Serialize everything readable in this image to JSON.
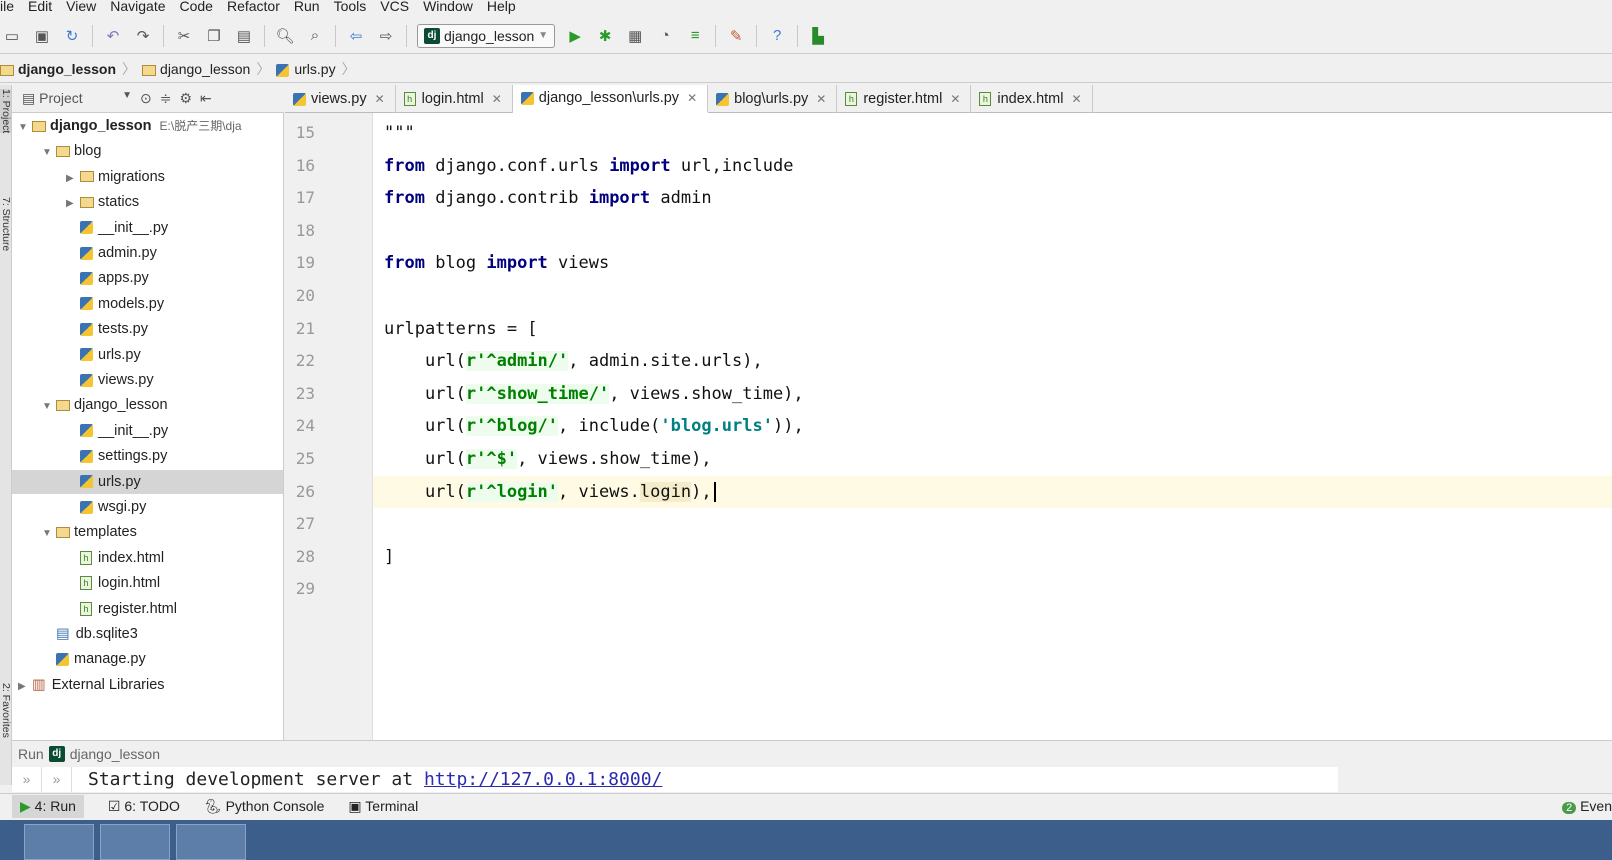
{
  "menu": [
    "ile",
    "Edit",
    "View",
    "Navigate",
    "Code",
    "Refactor",
    "Run",
    "Tools",
    "VCS",
    "Window",
    "Help"
  ],
  "toolbar": {
    "run_config": "django_lesson"
  },
  "breadcrumb": [
    "django_lesson",
    "django_lesson",
    "urls.py"
  ],
  "sidebar": {
    "title": "Project",
    "left_strip": [
      "1: Project",
      "7: Structure",
      "2: Favorites"
    ]
  },
  "tree": [
    {
      "label": "django_lesson",
      "extra": "E:\\脱产三期\\dja",
      "type": "folder",
      "depth": 0,
      "open": true
    },
    {
      "label": "blog",
      "type": "folder",
      "depth": 1,
      "open": true
    },
    {
      "label": "migrations",
      "type": "folder",
      "depth": 2,
      "open": false
    },
    {
      "label": "statics",
      "type": "folder",
      "depth": 2,
      "open": false
    },
    {
      "label": "__init__.py",
      "type": "py",
      "depth": 2
    },
    {
      "label": "admin.py",
      "type": "py",
      "depth": 2
    },
    {
      "label": "apps.py",
      "type": "py",
      "depth": 2
    },
    {
      "label": "models.py",
      "type": "py",
      "depth": 2
    },
    {
      "label": "tests.py",
      "type": "py",
      "depth": 2
    },
    {
      "label": "urls.py",
      "type": "py",
      "depth": 2
    },
    {
      "label": "views.py",
      "type": "py",
      "depth": 2
    },
    {
      "label": "django_lesson",
      "type": "folder",
      "depth": 1,
      "open": true
    },
    {
      "label": "__init__.py",
      "type": "py",
      "depth": 2
    },
    {
      "label": "settings.py",
      "type": "py",
      "depth": 2
    },
    {
      "label": "urls.py",
      "type": "py",
      "depth": 2,
      "selected": true
    },
    {
      "label": "wsgi.py",
      "type": "py",
      "depth": 2
    },
    {
      "label": "templates",
      "type": "folder",
      "depth": 1,
      "open": true
    },
    {
      "label": "index.html",
      "type": "html",
      "depth": 2
    },
    {
      "label": "login.html",
      "type": "html",
      "depth": 2
    },
    {
      "label": "register.html",
      "type": "html",
      "depth": 2
    },
    {
      "label": "db.sqlite3",
      "type": "db",
      "depth": 1
    },
    {
      "label": "manage.py",
      "type": "py",
      "depth": 1
    },
    {
      "label": "External Libraries",
      "type": "lib",
      "depth": 0,
      "open": false
    }
  ],
  "tabs": [
    {
      "label": "views.py",
      "type": "py"
    },
    {
      "label": "login.html",
      "type": "html"
    },
    {
      "label": "django_lesson\\urls.py",
      "type": "py",
      "active": true
    },
    {
      "label": "blog\\urls.py",
      "type": "py"
    },
    {
      "label": "register.html",
      "type": "html"
    },
    {
      "label": "index.html",
      "type": "html"
    }
  ],
  "code": [
    {
      "n": "15",
      "t": [
        [
          "c",
          "\"\"\""
        ]
      ]
    },
    {
      "n": "16",
      "t": [
        [
          "kw",
          "from"
        ],
        [
          "c",
          " django.conf.urls "
        ],
        [
          "kw",
          "import"
        ],
        [
          "c",
          " url,include"
        ]
      ]
    },
    {
      "n": "17",
      "t": [
        [
          "kw",
          "from"
        ],
        [
          "c",
          " django.contrib "
        ],
        [
          "kw",
          "import"
        ],
        [
          "c",
          " admin"
        ]
      ]
    },
    {
      "n": "18",
      "t": []
    },
    {
      "n": "19",
      "t": [
        [
          "kw",
          "from"
        ],
        [
          "c",
          " blog "
        ],
        [
          "kw",
          "import"
        ],
        [
          "c",
          " views"
        ]
      ]
    },
    {
      "n": "20",
      "t": []
    },
    {
      "n": "21",
      "t": [
        [
          "c",
          "urlpatterns = ["
        ]
      ]
    },
    {
      "n": "22",
      "t": [
        [
          "c",
          "    url("
        ],
        [
          "st",
          "r'^admin/'"
        ],
        [
          "c",
          ", admin.site.urls),"
        ]
      ]
    },
    {
      "n": "23",
      "t": [
        [
          "c",
          "    url("
        ],
        [
          "st",
          "r'^show_time/'"
        ],
        [
          "c",
          ", views.show_time),"
        ]
      ]
    },
    {
      "n": "24",
      "t": [
        [
          "c",
          "    url("
        ],
        [
          "st",
          "r'^blog/'"
        ],
        [
          "c",
          ", include("
        ],
        [
          "st2",
          "'blog.urls'"
        ],
        [
          "c",
          ")),"
        ]
      ]
    },
    {
      "n": "25",
      "t": [
        [
          "c",
          "    url("
        ],
        [
          "st",
          "r'^$'"
        ],
        [
          "c",
          ", views.show_time),"
        ]
      ]
    },
    {
      "n": "26",
      "t": [
        [
          "c",
          "    url("
        ],
        [
          "st",
          "r'^login'"
        ],
        [
          "c",
          ", views."
        ],
        [
          "hl",
          "login"
        ],
        [
          "c",
          "),"
        ]
      ],
      "current": true
    },
    {
      "n": "27",
      "t": []
    },
    {
      "n": "28",
      "t": [
        [
          "c",
          "]"
        ]
      ]
    },
    {
      "n": "29",
      "t": []
    }
  ],
  "run": {
    "label": "Run",
    "config": "django_lesson",
    "output": "Starting development server at ",
    "link": "http://127.0.0.1:8000/"
  },
  "toolwindows": [
    "4: Run",
    "6: TODO",
    "Python Console",
    "Terminal"
  ],
  "event_log": {
    "count": "2",
    "label": "Even"
  }
}
